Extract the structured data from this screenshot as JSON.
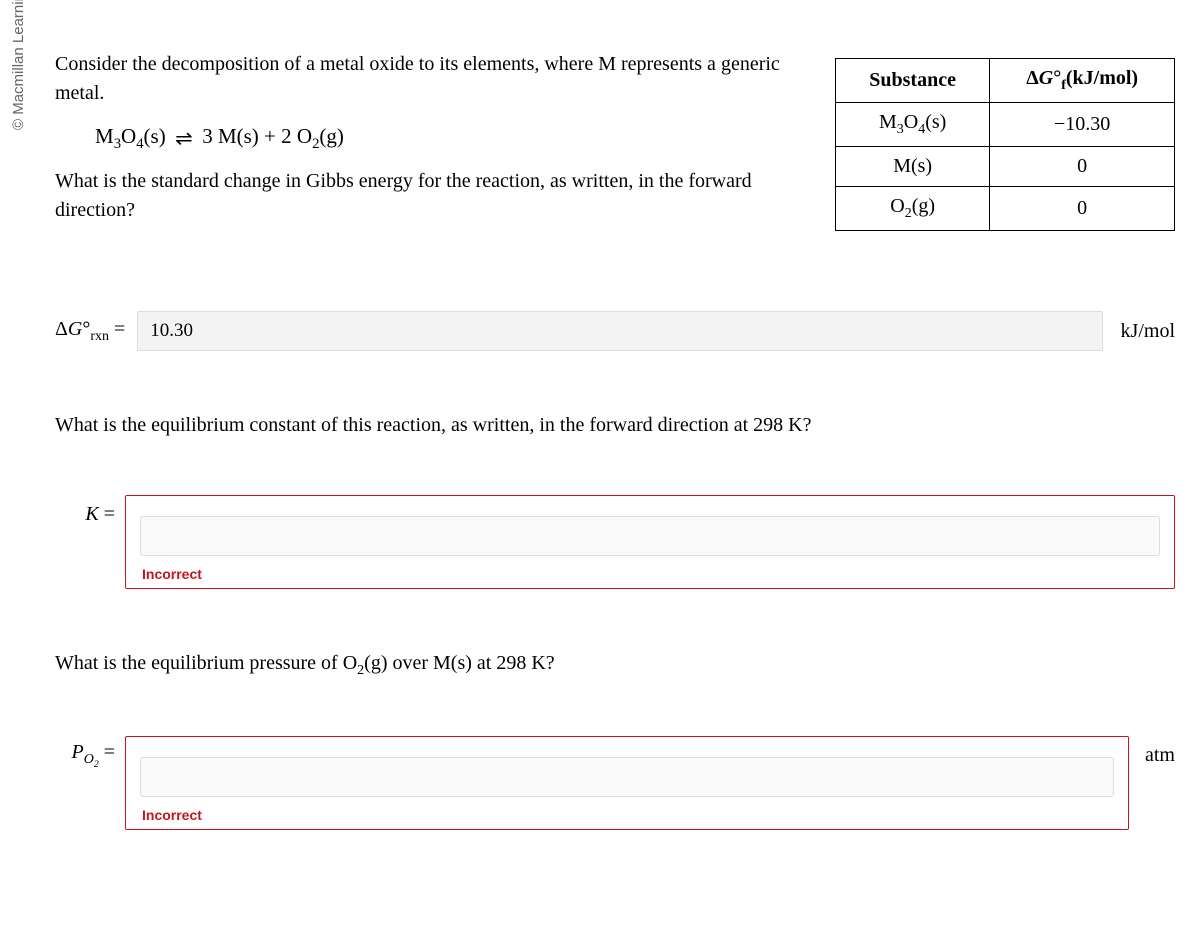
{
  "watermark": "© Macmillan Learning",
  "intro": "Consider the decomposition of a metal oxide to its elements, where M represents a generic metal.",
  "equation_lhs": "M₃O₄(s)",
  "equation_arrow": "⇌",
  "equation_rhs": "3 M(s) + 2 O₂(g)",
  "q1_text": "What is the standard change in Gibbs energy for the reaction, as written, in the forward direction?",
  "table": {
    "header1": "Substance",
    "header2": "ΔG°f(kJ/mol)",
    "rows": [
      {
        "substance": "M₃O₄(s)",
        "value": "−10.30"
      },
      {
        "substance": "M(s)",
        "value": "0"
      },
      {
        "substance": "O₂(g)",
        "value": "0"
      }
    ]
  },
  "answer1": {
    "label": "ΔG°rxn =",
    "value": "10.30",
    "unit": "kJ/mol"
  },
  "q2_text": "What is the equilibrium constant of this reaction, as written, in the forward direction at 298 K?",
  "answer2": {
    "label": "K =",
    "value": "",
    "feedback": "Incorrect"
  },
  "q3_text": "What is the equilibrium pressure of O₂(g) over M(s) at 298 K?",
  "answer3": {
    "label": "PO₂ =",
    "value": "",
    "unit": "atm",
    "feedback": "Incorrect"
  }
}
